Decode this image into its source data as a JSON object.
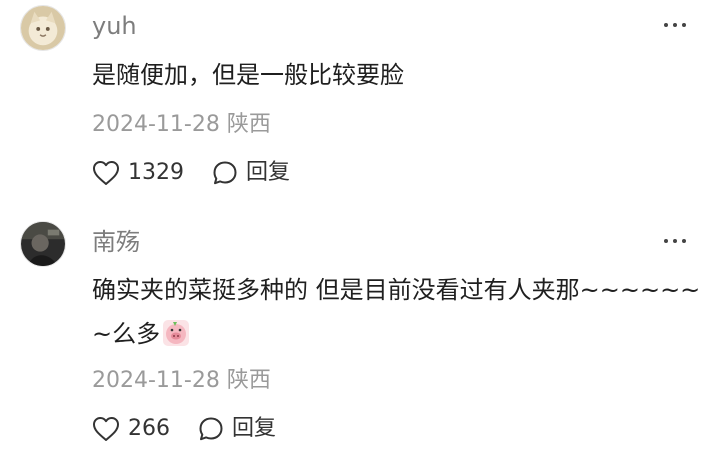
{
  "comments": [
    {
      "username": "yuh",
      "text": "是随便加，但是一般比较要脸",
      "date": "2024-11-28",
      "location": "陕西",
      "likes": "1329",
      "reply_label": "回复",
      "avatar_icon": "cat-avatar"
    },
    {
      "username": "南殇",
      "text": "确实夹的菜挺多种的 但是目前没看过有人夹那~~~~~~~么多",
      "date": "2024-11-28",
      "location": "陕西",
      "likes": "266",
      "reply_label": "回复",
      "avatar_icon": "dark-photo-avatar",
      "emoji_icon": "pig-sticker-emoji"
    }
  ],
  "icons": {
    "more": "more-dots-icon",
    "like": "heart-outline-icon",
    "reply": "speech-bubble-icon"
  }
}
